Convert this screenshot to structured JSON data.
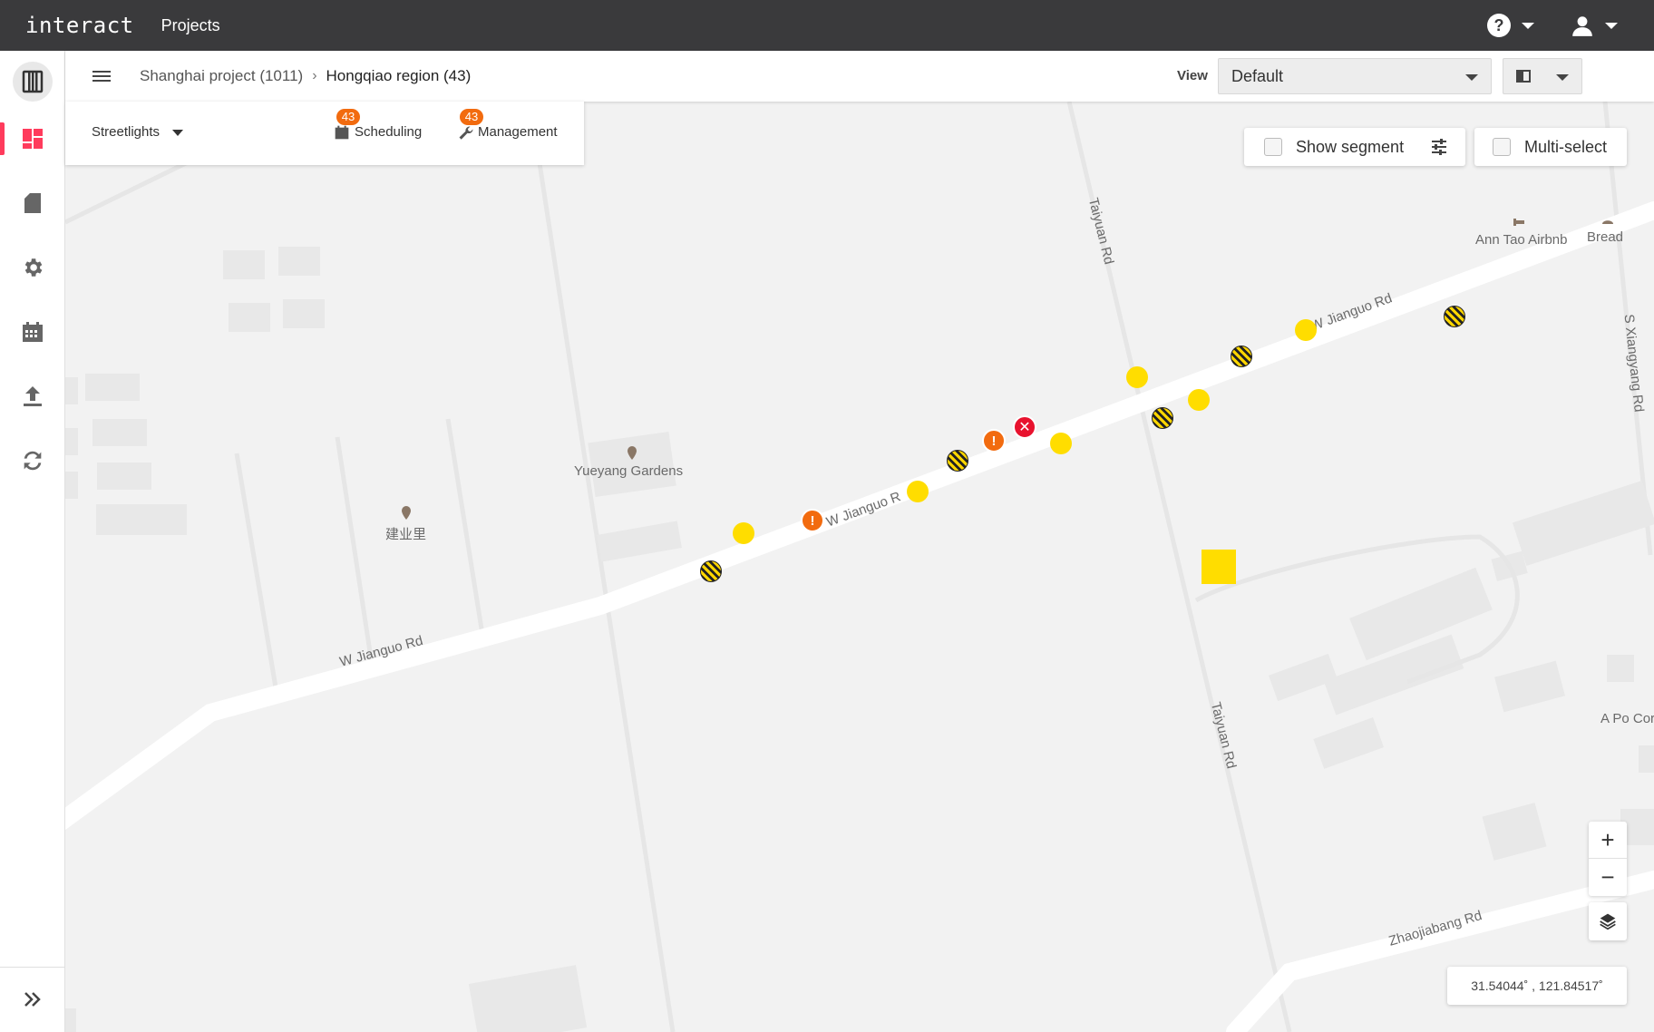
{
  "app": {
    "logo": "interact",
    "nav_projects": "Projects"
  },
  "breadcrumb": {
    "project": "Shanghai project (1011)",
    "separator": "›",
    "region": "Hongqiao region (43)"
  },
  "view": {
    "label": "View",
    "selected": "Default"
  },
  "filter": {
    "asset_type": "Streetlights",
    "scheduling": {
      "label": "Scheduling",
      "count": "43"
    },
    "management": {
      "label": "Management",
      "count": "43"
    }
  },
  "map_controls": {
    "show_segment": "Show segment",
    "multi_select": "Multi-select",
    "zoom_in": "+",
    "zoom_out": "−",
    "coordinates": "31.54044˚ , 121.84517˚"
  },
  "map_labels": {
    "w_jianguo_rd_1": "W Jianguo Rd",
    "w_jianguo_rd_2": "W Jianguo R",
    "w_jianguo_rd_3": "W Jianguo Rd",
    "taiyuan_rd_1": "Taiyuan Rd",
    "taiyuan_rd_2": "Taiyuan Rd",
    "s_xiangyang_rd": "S Xiangyang Rd",
    "zhaojiabang_rd": "Zhaojiabang Rd",
    "yueyang_gardens": "Yueyang Gardens",
    "jianyeli": "建业里",
    "ann_tao_airbnb": "Ann Tao Airbnb",
    "bread": "Bread",
    "a_po_cor": "A Po Cor"
  },
  "markers": {
    "ok": "ok",
    "partial": "partial",
    "warning": "!",
    "error": "✕"
  },
  "colors": {
    "topbar": "#3a3a3c",
    "active_accent": "#ff3b5c",
    "marker_yellow": "#ffdd00",
    "warning_orange": "#f26b0f",
    "error_red": "#e8122e"
  }
}
